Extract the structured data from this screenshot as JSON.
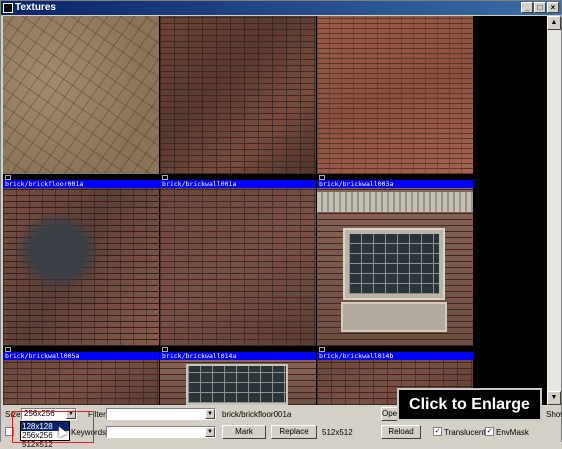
{
  "window": {
    "title": "Textures"
  },
  "textures": [
    {
      "label": "brick/brickfloor001a",
      "kind": "floor"
    },
    {
      "label": "brick/brickwall001a",
      "kind": "brick"
    },
    {
      "label": "brick/brickwall003a",
      "kind": "brick2"
    },
    {
      "label": "brick/brickwall005a",
      "kind": "brick3"
    },
    {
      "label": "brick/brickwall014a",
      "kind": "brick4"
    },
    {
      "label": "brick/brickwall014b",
      "kind": "window"
    }
  ],
  "panel": {
    "size_label": "Size:",
    "size_value": "256x256",
    "size_options": [
      "128x128",
      "256x256",
      "512x512"
    ],
    "filter_label": "Filter:",
    "selected_texture": "brick/brickfloor001a",
    "open_label": "Open",
    "show_label": "Show",
    "keywords_label": "Keywords:",
    "mark_label": "Mark",
    "replace_label": "Replace",
    "dimensions": "512x512",
    "reload_label": "Reload",
    "translucent_label": "Translucent",
    "envmask_label": "EnvMask"
  },
  "overlay": {
    "enlarge_label": "Click to Enlarge"
  },
  "colors": {
    "label_bar": "#0000ff",
    "titlebar": "#0a246a"
  }
}
